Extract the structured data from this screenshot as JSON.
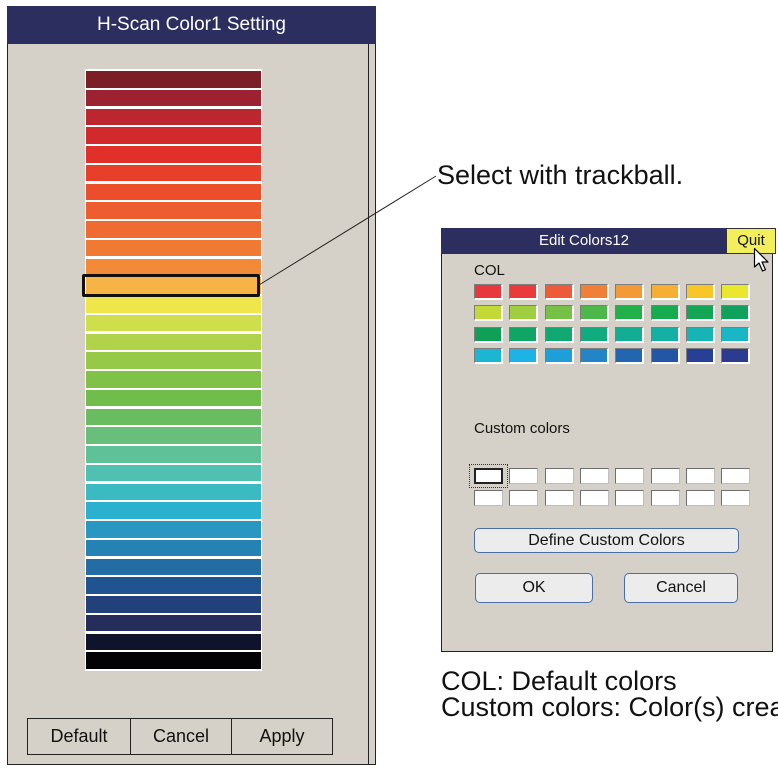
{
  "hscan": {
    "title": "H-Scan Color1 Setting",
    "color_levels": [
      "#7b1e26",
      "#9d2231",
      "#bc262f",
      "#d2292c",
      "#e1302a",
      "#e83f2a",
      "#ec4e2c",
      "#ee5d2f",
      "#ef6b31",
      "#f07a34",
      "#f28a38",
      "#f5b445",
      "#efe64b",
      "#cfdf4b",
      "#b1d349",
      "#97c948",
      "#80c248",
      "#70bd4c",
      "#6abc60",
      "#68be7b",
      "#5ec197",
      "#50c0b0",
      "#3cbac4",
      "#2cb0cf",
      "#2898c2",
      "#2582b4",
      "#236ca4",
      "#1f5490",
      "#22407a",
      "#252d5a",
      "#10132c",
      "#030305"
    ],
    "selected_level_index": 11,
    "buttons": {
      "default": "Default",
      "cancel": "Cancel",
      "apply": "Apply"
    }
  },
  "annotation": {
    "text": "Select with trackball."
  },
  "edit_colors": {
    "title": "Edit Colors12",
    "quit": "Quit",
    "basic_label": "COL",
    "basic_colors": [
      [
        "#e8383b",
        "#ea3a3c",
        "#ee5b3a",
        "#f17f36",
        "#f39a36",
        "#f6ae33",
        "#f8c626",
        "#e9e82f"
      ],
      [
        "#c3d935",
        "#9fce3e",
        "#74c145",
        "#4cb849",
        "#22b04b",
        "#17ab4f",
        "#12a655",
        "#10a15c"
      ],
      [
        "#0f9f57",
        "#0fa564",
        "#10a972",
        "#11ab80",
        "#12ae93",
        "#14b0a3",
        "#16b4b4",
        "#19b6c6"
      ],
      [
        "#1bb6d2",
        "#1db3e6",
        "#1f9fda",
        "#2185c8",
        "#2266b2",
        "#2456a6",
        "#273f95",
        "#2c3a90"
      ]
    ],
    "custom_label": "Custom colors",
    "custom_colors": [
      [
        "#ffffff",
        "#ffffff",
        "#ffffff",
        "#ffffff",
        "#ffffff",
        "#ffffff",
        "#ffffff",
        "#ffffff"
      ],
      [
        "#ffffff",
        "#ffffff",
        "#ffffff",
        "#ffffff",
        "#ffffff",
        "#ffffff",
        "#ffffff",
        "#ffffff"
      ]
    ],
    "focused_custom_index": 0,
    "define_button": "Define Custom Colors",
    "ok_button": "OK",
    "cancel_button": "Cancel"
  },
  "caption": {
    "line1": "COL: Default colors",
    "line2": "Custom colors: Color(s) crea"
  },
  "theme": {
    "title_bar": "#2c2e5f",
    "panel_bg": "#d5d1c9",
    "quit_bg": "#f3ee5b",
    "selection_outline": "#111111"
  },
  "icons": {
    "pointer": "mouse-pointer-icon"
  }
}
